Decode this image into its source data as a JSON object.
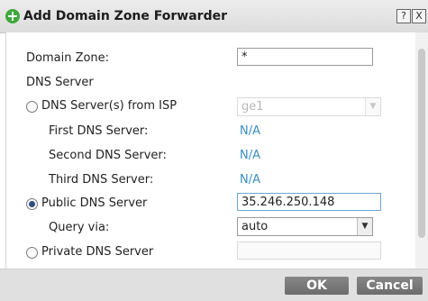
{
  "dialog": {
    "title": "Add Domain Zone Forwarder",
    "help_glyph": "?",
    "close_glyph": "X"
  },
  "form": {
    "domain_zone_label": "Domain Zone:",
    "domain_zone_value": "*",
    "dns_server_heading": "DNS Server",
    "isp_option_label": "DNS Server(s) from ISP",
    "isp_interface_value": "ge1",
    "first_dns_label": "First DNS Server:",
    "first_dns_value": "N/A",
    "second_dns_label": "Second DNS Server:",
    "second_dns_value": "N/A",
    "third_dns_label": "Third DNS Server:",
    "third_dns_value": "N/A",
    "public_option_label": "Public DNS Server",
    "public_dns_value": "35.246.250.148",
    "query_via_label": "Query via:",
    "query_via_value": "auto",
    "private_option_label": "Private DNS Server",
    "private_dns_value": "",
    "selected_option": "Public DNS Server"
  },
  "footer": {
    "ok_label": "OK",
    "cancel_label": "Cancel"
  },
  "colors": {
    "link_value": "#3a8fc0",
    "button_bg": "#7a7a7a",
    "title_icon": "#3ea83c",
    "radio_selected": "#2e4e7e"
  },
  "icons": {
    "title_icon": "add-icon",
    "select_arrow": "chevron-down-icon"
  }
}
